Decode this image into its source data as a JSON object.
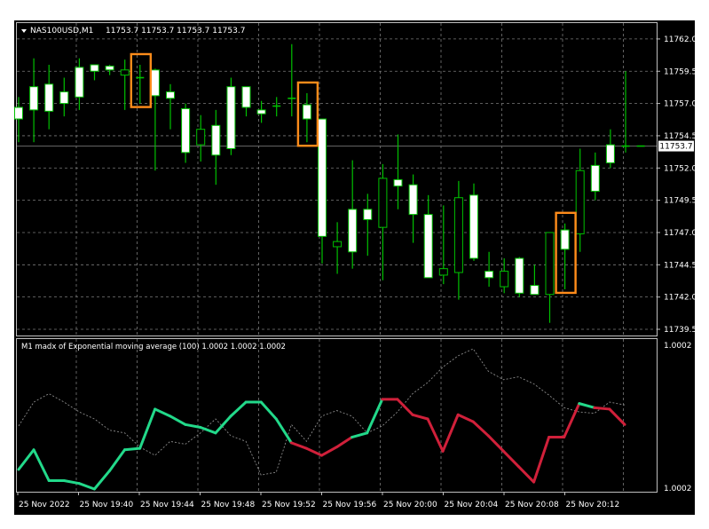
{
  "window": {
    "symbol_header": "NAS100USD,M1",
    "ohlc_header": "11753.7 11753.7 11753.7 11753.7",
    "indicator_header": "M1 madx of  Exponential moving average (100) 1.0002 1.0002 1.0002"
  },
  "colors": {
    "background": "#000000",
    "bull_body": "#ffffff",
    "bear_body": "#000000",
    "wick": "#00c000",
    "grid": "#7a7a7a",
    "price_line": "#6a6a6a",
    "highlight_box": "#ff8c1a",
    "indicator_up": "#22d98a",
    "indicator_down": "#d0203a",
    "indicator_dotted": "#8a8a8a",
    "axis_text": "#ffffff"
  },
  "chart_data": [
    {
      "type": "candlestick",
      "title": "NAS100USD,M1",
      "current_price": 11753.7,
      "current_price_label": "11753.7",
      "ylim": [
        11738.5,
        11763.0
      ],
      "y_ticks": [
        "11762.0",
        "11759.5",
        "11757.0",
        "11754.5",
        "11752.0",
        "11749.5",
        "11747.0",
        "11744.5",
        "11742.0",
        "11739.5"
      ],
      "y_tick_values": [
        11762.0,
        11759.5,
        11757.0,
        11754.5,
        11752.0,
        11749.5,
        11747.0,
        11744.5,
        11742.0,
        11739.5
      ],
      "grid": true,
      "candles": [
        {
          "o": 11755.8,
          "h": 11757.5,
          "l": 11754.0,
          "c": 11756.7
        },
        {
          "o": 11756.5,
          "h": 11760.5,
          "l": 11754.0,
          "c": 11758.3
        },
        {
          "o": 11756.4,
          "h": 11760.0,
          "l": 11755.0,
          "c": 11758.5
        },
        {
          "o": 11757.0,
          "h": 11759.0,
          "l": 11756.0,
          "c": 11757.9
        },
        {
          "o": 11757.5,
          "h": 11760.5,
          "l": 11756.5,
          "c": 11759.8
        },
        {
          "o": 11759.5,
          "h": 11760.0,
          "l": 11758.8,
          "c": 11760.0
        },
        {
          "o": 11759.6,
          "h": 11760.0,
          "l": 11759.2,
          "c": 11759.9
        },
        {
          "o": 11759.6,
          "h": 11760.4,
          "l": 11756.5,
          "c": 11759.2
        },
        {
          "o": 11759.1,
          "h": 11760.0,
          "l": 11757.0,
          "c": 11759.0
        },
        {
          "o": 11757.6,
          "h": 11759.7,
          "l": 11751.8,
          "c": 11759.6
        },
        {
          "o": 11757.4,
          "h": 11758.5,
          "l": 11755.0,
          "c": 11757.9
        },
        {
          "o": 11753.2,
          "h": 11757.0,
          "l": 11752.4,
          "c": 11756.6
        },
        {
          "o": 11755.0,
          "h": 11756.1,
          "l": 11752.5,
          "c": 11753.8
        },
        {
          "o": 11753.0,
          "h": 11756.5,
          "l": 11750.7,
          "c": 11755.3
        },
        {
          "o": 11753.5,
          "h": 11759.0,
          "l": 11753.0,
          "c": 11758.3
        },
        {
          "o": 11756.7,
          "h": 11758.3,
          "l": 11756.0,
          "c": 11758.3
        },
        {
          "o": 11756.2,
          "h": 11757.2,
          "l": 11755.5,
          "c": 11756.5
        },
        {
          "o": 11756.8,
          "h": 11757.5,
          "l": 11756.0,
          "c": 11756.8
        },
        {
          "o": 11757.4,
          "h": 11761.6,
          "l": 11756.0,
          "c": 11757.4
        },
        {
          "o": 11755.8,
          "h": 11757.8,
          "l": 11754.0,
          "c": 11756.9
        },
        {
          "o": 11746.7,
          "h": 11755.5,
          "l": 11744.6,
          "c": 11755.8
        },
        {
          "o": 11746.3,
          "h": 11747.8,
          "l": 11743.8,
          "c": 11745.9
        },
        {
          "o": 11745.5,
          "h": 11752.6,
          "l": 11744.2,
          "c": 11748.8
        },
        {
          "o": 11748.0,
          "h": 11750.0,
          "l": 11745.2,
          "c": 11748.8
        },
        {
          "o": 11751.2,
          "h": 11752.3,
          "l": 11743.3,
          "c": 11747.4
        },
        {
          "o": 11750.6,
          "h": 11754.6,
          "l": 11748.8,
          "c": 11751.1
        },
        {
          "o": 11748.4,
          "h": 11751.5,
          "l": 11746.2,
          "c": 11750.7
        },
        {
          "o": 11743.5,
          "h": 11749.9,
          "l": 11743.5,
          "c": 11748.4
        },
        {
          "o": 11744.2,
          "h": 11749.1,
          "l": 11743.0,
          "c": 11743.7
        },
        {
          "o": 11749.7,
          "h": 11751.0,
          "l": 11741.8,
          "c": 11743.9
        },
        {
          "o": 11745.0,
          "h": 11750.8,
          "l": 11744.8,
          "c": 11749.9
        },
        {
          "o": 11743.5,
          "h": 11745.5,
          "l": 11742.8,
          "c": 11744.0
        },
        {
          "o": 11744.0,
          "h": 11745.0,
          "l": 11742.3,
          "c": 11742.8
        },
        {
          "o": 11742.3,
          "h": 11745.1,
          "l": 11742.0,
          "c": 11745.0
        },
        {
          "o": 11742.2,
          "h": 11744.5,
          "l": 11742.2,
          "c": 11742.9
        },
        {
          "o": 11747.0,
          "h": 11747.0,
          "l": 11740.0,
          "c": 11742.2
        },
        {
          "o": 11745.7,
          "h": 11747.7,
          "l": 11742.6,
          "c": 11747.2
        },
        {
          "o": 11751.8,
          "h": 11753.5,
          "l": 11745.5,
          "c": 11746.9
        },
        {
          "o": 11750.2,
          "h": 11753.2,
          "l": 11749.5,
          "c": 11752.2
        },
        {
          "o": 11752.4,
          "h": 11755.0,
          "l": 11752.0,
          "c": 11753.8
        },
        {
          "o": 11753.7,
          "h": 11759.5,
          "l": 11753.2,
          "c": 11753.7
        },
        {
          "o": 11753.7,
          "h": 11753.7,
          "l": 11753.7,
          "c": 11753.7
        }
      ],
      "highlight_candles": [
        8,
        19,
        36
      ]
    },
    {
      "type": "line",
      "title": "M1 madx of  Exponential moving average (100)",
      "ylim": [
        1.00018,
        1.00022
      ],
      "y_ticks": [
        "1.0002",
        "1.0002"
      ],
      "y_tick_values": [
        1.000218,
        1.000182
      ],
      "x_labels": [
        "25 Nov 2022",
        "25 Nov 19:40",
        "25 Nov 19:44",
        "25 Nov 19:48",
        "25 Nov 19:52",
        "25 Nov 19:56",
        "25 Nov 20:00",
        "25 Nov 20:04",
        "25 Nov 20:08",
        "25 Nov 20:12"
      ],
      "series": [
        {
          "style": "colored",
          "values": [
            0.14,
            0.28,
            0.06,
            0.06,
            0.04,
            0.0,
            0.13,
            0.28,
            0.29,
            0.57,
            0.52,
            0.46,
            0.44,
            0.4,
            0.52,
            0.62,
            0.62,
            0.5,
            0.33,
            0.29,
            0.24,
            0.3,
            0.37,
            0.4,
            0.64,
            0.64,
            0.53,
            0.5,
            0.27,
            0.53,
            0.48,
            0.38,
            0.27,
            0.16,
            0.05,
            0.37,
            0.37,
            0.61,
            0.58,
            0.57,
            0.46
          ],
          "trend": [
            "down",
            "up",
            "up",
            "up",
            "up",
            "up",
            "up",
            "up",
            "up",
            "up",
            "up",
            "up",
            "up",
            "up",
            "up",
            "up",
            "up",
            "up",
            "up",
            "down",
            "down",
            "down",
            "down",
            "up",
            "up",
            "down",
            "down",
            "down",
            "down",
            "down",
            "down",
            "down",
            "down",
            "down",
            "down",
            "down",
            "down",
            "down",
            "up",
            "down",
            "down"
          ]
        },
        {
          "style": "dotted",
          "values": [
            0.45,
            0.62,
            0.68,
            0.62,
            0.55,
            0.5,
            0.42,
            0.4,
            0.3,
            0.24,
            0.34,
            0.32,
            0.4,
            0.5,
            0.38,
            0.34,
            0.1,
            0.12,
            0.46,
            0.34,
            0.52,
            0.56,
            0.52,
            0.4,
            0.45,
            0.55,
            0.68,
            0.76,
            0.87,
            0.95,
            1.0,
            0.84,
            0.78,
            0.8,
            0.75,
            0.67,
            0.58,
            0.55,
            0.54,
            0.62,
            0.6
          ]
        }
      ]
    }
  ]
}
